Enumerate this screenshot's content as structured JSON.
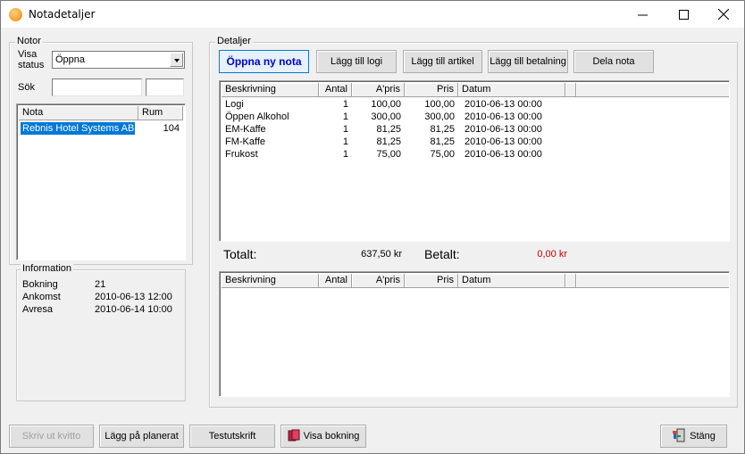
{
  "window": {
    "title": "Notadetaljer"
  },
  "notor": {
    "legend": "Notor",
    "visa_status_label_1": "Visa",
    "visa_status_label_2": "status",
    "status_value": "Öppna",
    "sok_label": "Sök",
    "search_value": "",
    "search_value_2": "",
    "columns": [
      "Nota",
      "Rum"
    ],
    "rows": [
      {
        "nota": "Rebnis Hotel Systems AB",
        "rum": "104",
        "selected": true
      }
    ]
  },
  "information": {
    "legend": "Information",
    "rows": [
      {
        "label": "Bokning",
        "value": "21"
      },
      {
        "label": "Ankomst",
        "value": "2010-06-13 12:00"
      },
      {
        "label": "Avresa",
        "value": "2010-06-14 10:00"
      }
    ]
  },
  "detaljer": {
    "legend": "Detaljer",
    "buttons": {
      "open_nota": "Öppna ny nota",
      "add_logi": "Lägg till logi",
      "add_artikel": "Lägg till artikel",
      "add_betalning": "Lägg till betalning",
      "dela_nota": "Dela nota"
    },
    "columns": [
      "Beskrivning",
      "Antal",
      "A'pris",
      "Pris",
      "Datum"
    ],
    "items": [
      {
        "beskrivning": "Logi",
        "antal": "1",
        "apris": "100,00",
        "pris": "100,00",
        "datum": "2010-06-13 00:00"
      },
      {
        "beskrivning": "Öppen Alkohol",
        "antal": "1",
        "apris": "300,00",
        "pris": "300,00",
        "datum": "2010-06-13 00:00"
      },
      {
        "beskrivning": "EM-Kaffe",
        "antal": "1",
        "apris": "81,25",
        "pris": "81,25",
        "datum": "2010-06-13 00:00"
      },
      {
        "beskrivning": "FM-Kaffe",
        "antal": "1",
        "apris": "81,25",
        "pris": "81,25",
        "datum": "2010-06-13 00:00"
      },
      {
        "beskrivning": "Frukost",
        "antal": "1",
        "apris": "75,00",
        "pris": "75,00",
        "datum": "2010-06-13 00:00"
      }
    ],
    "totalt_label": "Totalt:",
    "totalt_value": "637,50 kr",
    "betalt_label": "Betalt:",
    "betalt_value": "0,00 kr",
    "betalt_color": "#cc0000",
    "payment_columns": [
      "Beskrivning",
      "Antal",
      "A'pris",
      "Pris",
      "Datum"
    ]
  },
  "footer": {
    "skriv_ut_kvitto": "Skriv ut kvitto",
    "lagg_pa_planerat": "Lägg på planerat",
    "testutskrift": "Testutskrift",
    "visa_bokning": "Visa bokning",
    "stang": "Stäng"
  }
}
